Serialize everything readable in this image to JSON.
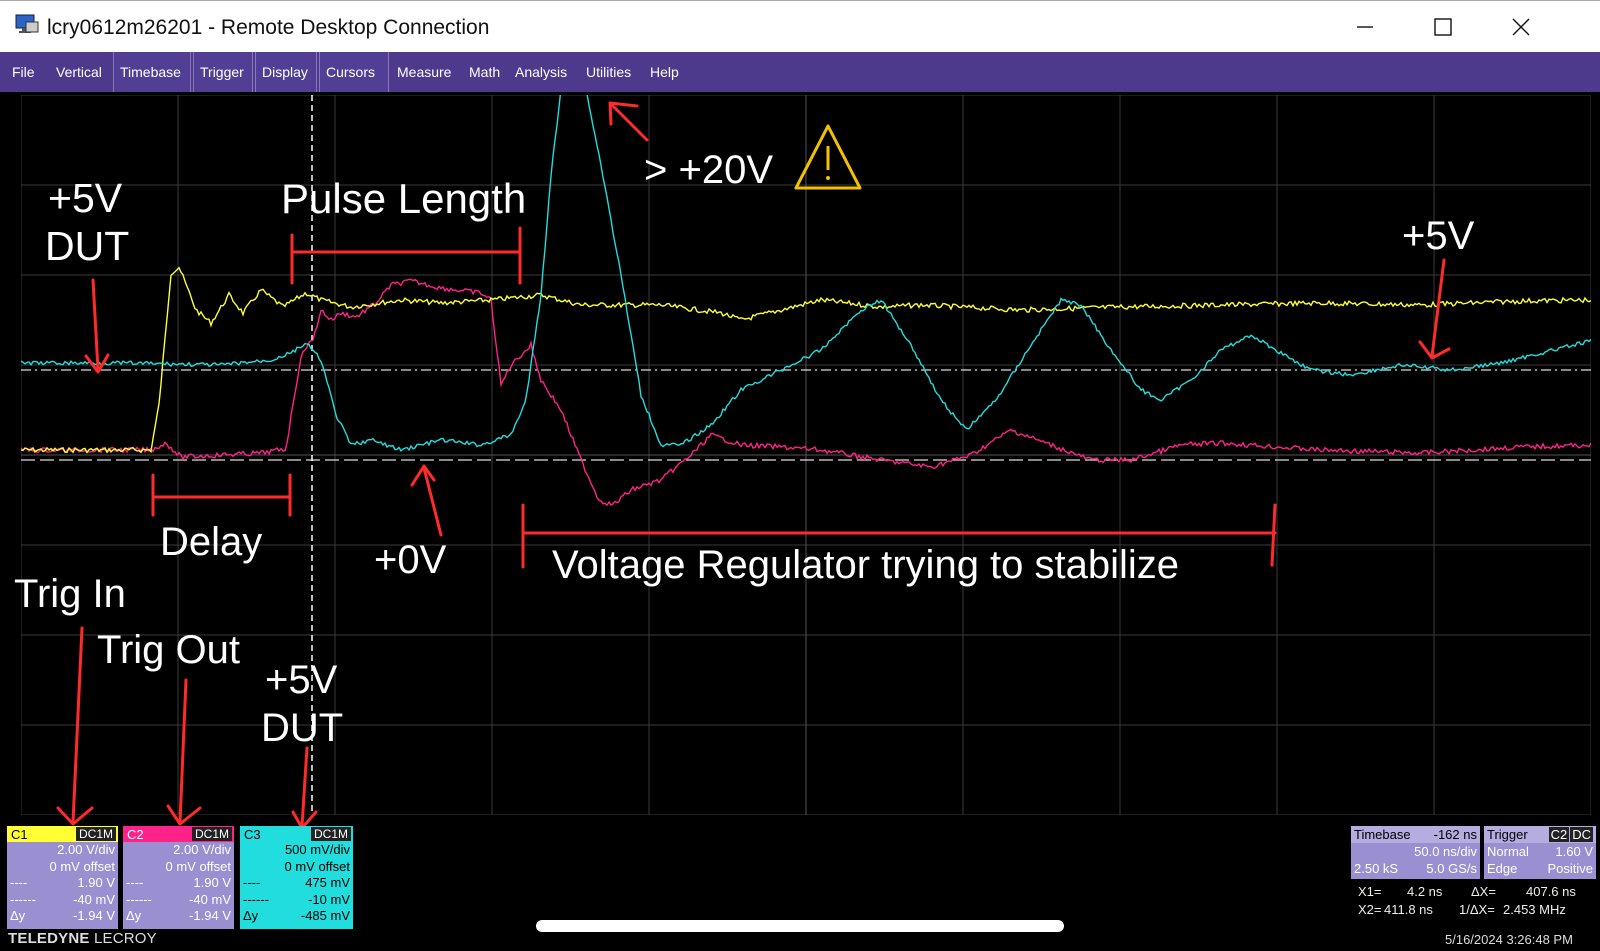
{
  "window": {
    "title": "lcry0612m26201 - Remote Desktop Connection",
    "minimize_glyph": "—",
    "maximize_glyph": "☐",
    "close_glyph": "✕",
    "icon": "remote-desktop-icon"
  },
  "menu": [
    {
      "label": "File"
    },
    {
      "label": "Vertical"
    },
    {
      "label": "Timebase"
    },
    {
      "label": "Trigger"
    },
    {
      "label": "Display"
    },
    {
      "label": "Cursors"
    },
    {
      "label": "Measure"
    },
    {
      "label": "Math"
    },
    {
      "label": "Analysis"
    },
    {
      "label": "Utilities"
    },
    {
      "label": "Help"
    }
  ],
  "annotations": {
    "dut_top": "+5V",
    "dut_top_2": "DUT",
    "pulse_length": "Pulse Length",
    "overshoot": "> +20V",
    "right_5v": "+5V",
    "delay": "Delay",
    "zero_v": "+0V",
    "regulator": "Voltage Regulator trying to stabilize",
    "trig_in": "Trig In",
    "trig_out": "Trig Out",
    "dut_bottom": "+5V",
    "dut_bottom_2": "DUT",
    "warning_icon": "warning-triangle-icon"
  },
  "channel_marker": "C3",
  "channels": [
    {
      "name": "C1",
      "coupling": "DC1M",
      "vdiv": "2.00 V/div",
      "offset": "0 mV offset",
      "row1_lbl": "----",
      "row1_val": "1.90 V",
      "row2_lbl": "------",
      "row2_val": "-40 mV",
      "row3_lbl": "Δy",
      "row3_val": "-1.94 V",
      "color": "#ffff33"
    },
    {
      "name": "C2",
      "coupling": "DC1M",
      "vdiv": "2.00 V/div",
      "offset": "0 mV offset",
      "row1_lbl": "----",
      "row1_val": "1.90 V",
      "row2_lbl": "------",
      "row2_val": "-40 mV",
      "row3_lbl": "Δy",
      "row3_val": "-1.94 V",
      "color": "#ff2288"
    },
    {
      "name": "C3",
      "coupling": "DC1M",
      "vdiv": "500 mV/div",
      "offset": "0 mV offset",
      "row1_lbl": "----",
      "row1_val": "475 mV",
      "row2_lbl": "------",
      "row2_val": "-10 mV",
      "row3_lbl": "Δy",
      "row3_val": "-485 mV",
      "color": "#22dddd"
    }
  ],
  "brand": {
    "a": "TELEDYNE",
    "b": "LECROY"
  },
  "timebase": {
    "label": "Timebase",
    "delay": "-162 ns",
    "div": "50.0 ns/div",
    "samples": "2.50 kS",
    "rate": "5.0 GS/s"
  },
  "trigger": {
    "label": "Trigger",
    "source": "C2",
    "coupling": "DC",
    "mode": "Normal",
    "level": "1.60 V",
    "type": "Edge",
    "slope": "Positive"
  },
  "cursors": {
    "x1_label": "X1=",
    "x1": "4.2 ns",
    "dx_label": "ΔX=",
    "dx": "407.6 ns",
    "x2_label": "X2=",
    "x2": "411.8 ns",
    "inv_dx_label": "1/ΔX=",
    "inv_dx": "2.453 MHz"
  },
  "timestamp": "5/16/2024 3:26:48 PM",
  "colors": {
    "menu_bg": "#4d3a8c",
    "trace_c1": "#ffff33",
    "trace_c2": "#ff2288",
    "trace_c3": "#22dddd",
    "annotation_red": "#ff2a2a",
    "warning": "#f2c200",
    "grid": "#3a3a3a"
  }
}
